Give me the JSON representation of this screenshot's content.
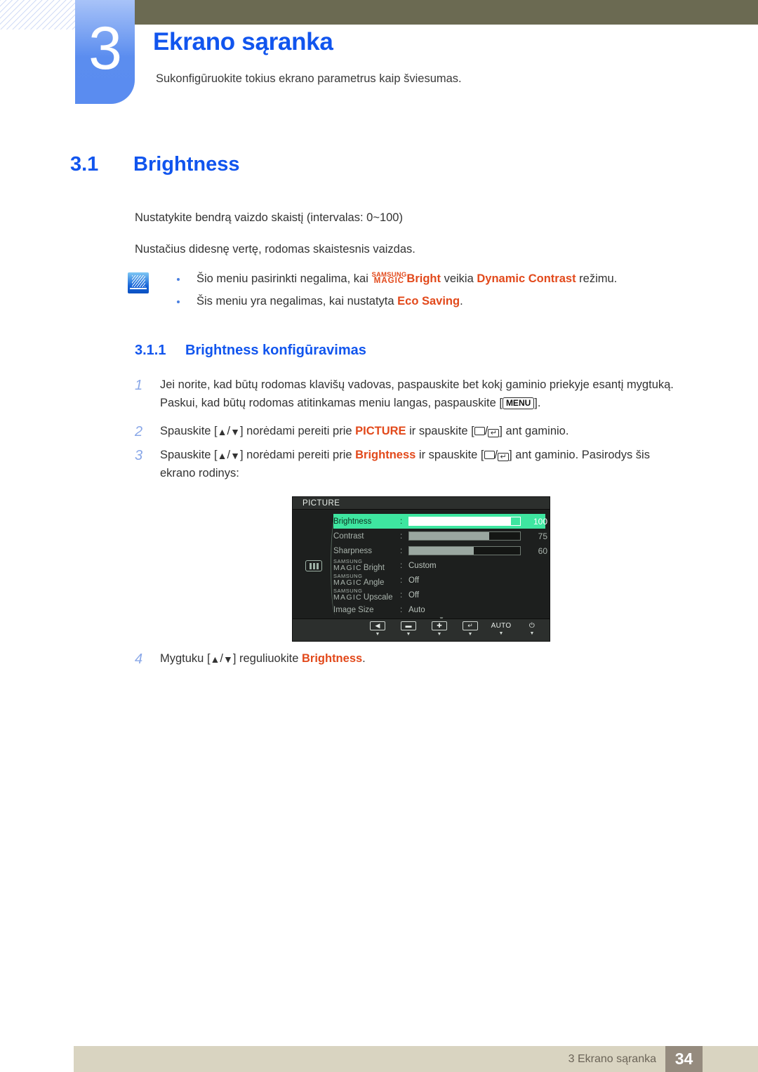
{
  "header": {
    "chapter_number": "3",
    "chapter_title": "Ekrano sąranka",
    "chapter_description": "Sukonfigūruokite tokius ekrano parametrus kaip šviesumas."
  },
  "section": {
    "number": "3.1",
    "title": "Brightness"
  },
  "paragraphs": {
    "p1": "Nustatykite bendrą vaizdo skaistį (intervalas: 0~100)",
    "p2": "Nustačius didesnę vertę, rodomas skaistesnis vaizdas."
  },
  "note": {
    "icon": "note-pencil-icon",
    "items": [
      {
        "pre": "Šio meniu pasirinkti negalima, kai ",
        "magic_top": "SAMSUNG",
        "magic_bottom": "MAGIC",
        "magic_word": "Bright",
        "mid": " veikia ",
        "highlight": "Dynamic Contrast",
        "post": " režimu."
      },
      {
        "pre": "Šis meniu yra negalimas, kai nustatyta ",
        "highlight": "Eco Saving",
        "post": "."
      }
    ]
  },
  "subsection": {
    "number": "3.1.1",
    "title": "Brightness konfigūravimas"
  },
  "steps": [
    {
      "num": "1",
      "line1_a": "Jei norite, kad būtų rodomas klavišų vadovas, paspauskite bet kokį gaminio priekyje esantį mygtuką.",
      "line2_a": "Paskui, kad būtų rodomas atitinkamas meniu langas, paspauskite [",
      "key": "MENU",
      "line2_b": "]."
    },
    {
      "num": "2",
      "a": "Spauskite [",
      "up": "▲",
      "slash": "/",
      "down": "▼",
      "b": "] norėdami pereiti prie ",
      "highlight": "PICTURE",
      "c": " ir spauskite [",
      "d": "/",
      "e": "] ant gaminio."
    },
    {
      "num": "3",
      "a": "Spauskite [",
      "up": "▲",
      "slash": "/",
      "down": "▼",
      "b": "] norėdami pereiti prie ",
      "highlight": "Brightness",
      "c": " ir spauskite [",
      "d": "/",
      "e": "] ant gaminio. Pasirodys šis",
      "line2": "ekrano rodinys:"
    },
    {
      "num": "4",
      "a": "Mygtuku [",
      "up": "▲",
      "slash": "/",
      "down": "▼",
      "b": "] reguliuokite ",
      "highlight": "Brightness",
      "c": "."
    }
  ],
  "osd": {
    "title": "PICTURE",
    "sidebar_icon": "picture-bars-icon",
    "rows": [
      {
        "label": "Brightness",
        "type": "slider",
        "value": "100",
        "fill_percent": 92,
        "active": true
      },
      {
        "label": "Contrast",
        "type": "slider",
        "value": "75",
        "fill_percent": 72,
        "active": false
      },
      {
        "label": "Sharpness",
        "type": "slider",
        "value": "60",
        "fill_percent": 58,
        "active": false
      },
      {
        "label_magic_top": "SAMSUNG",
        "label_magic_mid": "MAGIC",
        "label_magic_word": "Bright",
        "type": "text",
        "value": "Custom",
        "active": false
      },
      {
        "label_magic_top": "SAMSUNG",
        "label_magic_mid": "MAGIC",
        "label_magic_word": "Angle",
        "type": "text",
        "value": "Off",
        "active": false
      },
      {
        "label_magic_top": "SAMSUNG",
        "label_magic_mid": "MAGIC",
        "label_magic_word": "Upscale",
        "type": "text",
        "value": "Off",
        "active": false
      },
      {
        "label": "Image Size",
        "type": "text",
        "value": "Auto",
        "active": false
      }
    ],
    "scroll_indicator": "▼",
    "footer_buttons": [
      {
        "name": "back-button",
        "glyph": "◀",
        "caret": "▼"
      },
      {
        "name": "minus-button",
        "glyph": "▬",
        "caret": "▼"
      },
      {
        "name": "plus-button",
        "glyph": "✚",
        "caret": "▼"
      },
      {
        "name": "enter-button",
        "glyph": "↵",
        "caret": "▼"
      },
      {
        "name": "auto-button",
        "label": "AUTO",
        "caret": "▼"
      },
      {
        "name": "power-button",
        "label": "⏻",
        "caret": "▼"
      }
    ]
  },
  "footer": {
    "text": "3 Ekrano sąranka",
    "page": "34"
  },
  "colors": {
    "accent_blue": "#1155ee",
    "chapter_block_blue": "#5b8def",
    "olive_bar": "#6b6a52",
    "highlight_red": "#e2491b",
    "osd_green": "#3ee6a0",
    "footer_bar": "#d9d4c1",
    "page_box": "#958b7e"
  }
}
